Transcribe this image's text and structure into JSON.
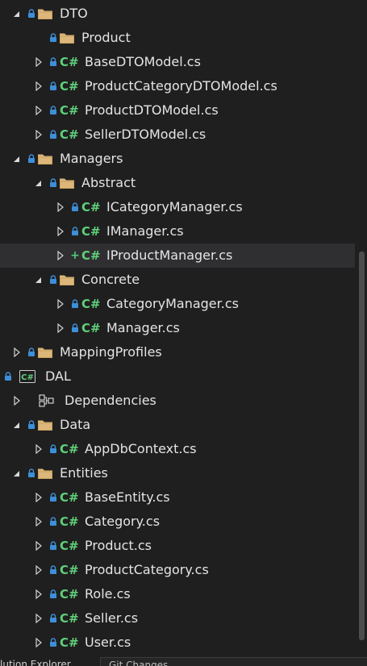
{
  "tree": [
    {
      "label": "DTO",
      "depth": 0,
      "expand": "open",
      "lock": true,
      "type": "folder"
    },
    {
      "label": "Product",
      "depth": 1,
      "expand": "none",
      "lock": true,
      "type": "folder"
    },
    {
      "label": "BaseDTOModel.cs",
      "depth": 1,
      "expand": "closed",
      "lock": true,
      "type": "cs"
    },
    {
      "label": "ProductCategoryDTOModel.cs",
      "depth": 1,
      "expand": "closed",
      "lock": true,
      "type": "cs"
    },
    {
      "label": "ProductDTOModel.cs",
      "depth": 1,
      "expand": "closed",
      "lock": true,
      "type": "cs"
    },
    {
      "label": "SellerDTOModel.cs",
      "depth": 1,
      "expand": "closed",
      "lock": true,
      "type": "cs"
    },
    {
      "label": "Managers",
      "depth": 0,
      "expand": "open",
      "lock": true,
      "type": "folder"
    },
    {
      "label": "Abstract",
      "depth": 1,
      "expand": "open",
      "lock": true,
      "type": "folder"
    },
    {
      "label": "ICategoryManager.cs",
      "depth": 2,
      "expand": "closed",
      "lock": true,
      "type": "cs"
    },
    {
      "label": "IManager.cs",
      "depth": 2,
      "expand": "closed",
      "lock": true,
      "type": "cs"
    },
    {
      "label": "IProductManager.cs",
      "depth": 2,
      "expand": "closed",
      "lock": false,
      "plus": true,
      "type": "cs",
      "selected": true
    },
    {
      "label": "Concrete",
      "depth": 1,
      "expand": "open",
      "lock": true,
      "type": "folder"
    },
    {
      "label": "CategoryManager.cs",
      "depth": 2,
      "expand": "closed",
      "lock": true,
      "type": "cs"
    },
    {
      "label": "Manager.cs",
      "depth": 2,
      "expand": "closed",
      "lock": true,
      "type": "cs"
    },
    {
      "label": "MappingProfiles",
      "depth": 0,
      "expand": "closed",
      "lock": true,
      "type": "folder"
    },
    {
      "label": "DAL",
      "depth": -1,
      "expand": "none",
      "lock": true,
      "type": "project"
    },
    {
      "label": "Dependencies",
      "depth": 0,
      "expand": "closed",
      "lock": false,
      "type": "deps"
    },
    {
      "label": "Data",
      "depth": 0,
      "expand": "open",
      "lock": true,
      "type": "folder"
    },
    {
      "label": "AppDbContext.cs",
      "depth": 1,
      "expand": "closed",
      "lock": true,
      "type": "cs"
    },
    {
      "label": "Entities",
      "depth": 0,
      "expand": "open",
      "lock": true,
      "type": "folder"
    },
    {
      "label": "BaseEntity.cs",
      "depth": 1,
      "expand": "closed",
      "lock": true,
      "type": "cs"
    },
    {
      "label": "Category.cs",
      "depth": 1,
      "expand": "closed",
      "lock": true,
      "type": "cs"
    },
    {
      "label": "Product.cs",
      "depth": 1,
      "expand": "closed",
      "lock": true,
      "type": "cs"
    },
    {
      "label": "ProductCategory.cs",
      "depth": 1,
      "expand": "closed",
      "lock": true,
      "type": "cs"
    },
    {
      "label": "Role.cs",
      "depth": 1,
      "expand": "closed",
      "lock": true,
      "type": "cs"
    },
    {
      "label": "Seller.cs",
      "depth": 1,
      "expand": "closed",
      "lock": true,
      "type": "cs"
    },
    {
      "label": "User.cs",
      "depth": 1,
      "expand": "closed",
      "lock": true,
      "type": "cs"
    }
  ],
  "cs_glyph": "C#",
  "project_glyph": "C#",
  "bottom": {
    "tab": "lution Explorer",
    "git": "Git Changes"
  },
  "colors": {
    "background": "#1f1f1f",
    "selected": "#2f2f31",
    "folder": "#dcb67a",
    "cs": "#5fd07a",
    "lock": "#3c8fd8",
    "text": "#e4e4e4"
  },
  "icons": {
    "folder": "folder-icon",
    "lock": "lock-icon",
    "cs": "csharp-file-icon",
    "project": "csharp-project-icon",
    "deps": "dependencies-icon",
    "expand_open": "expanded-triangle-icon",
    "expand_closed": "collapsed-triangle-icon",
    "plus": "pending-add-icon"
  }
}
